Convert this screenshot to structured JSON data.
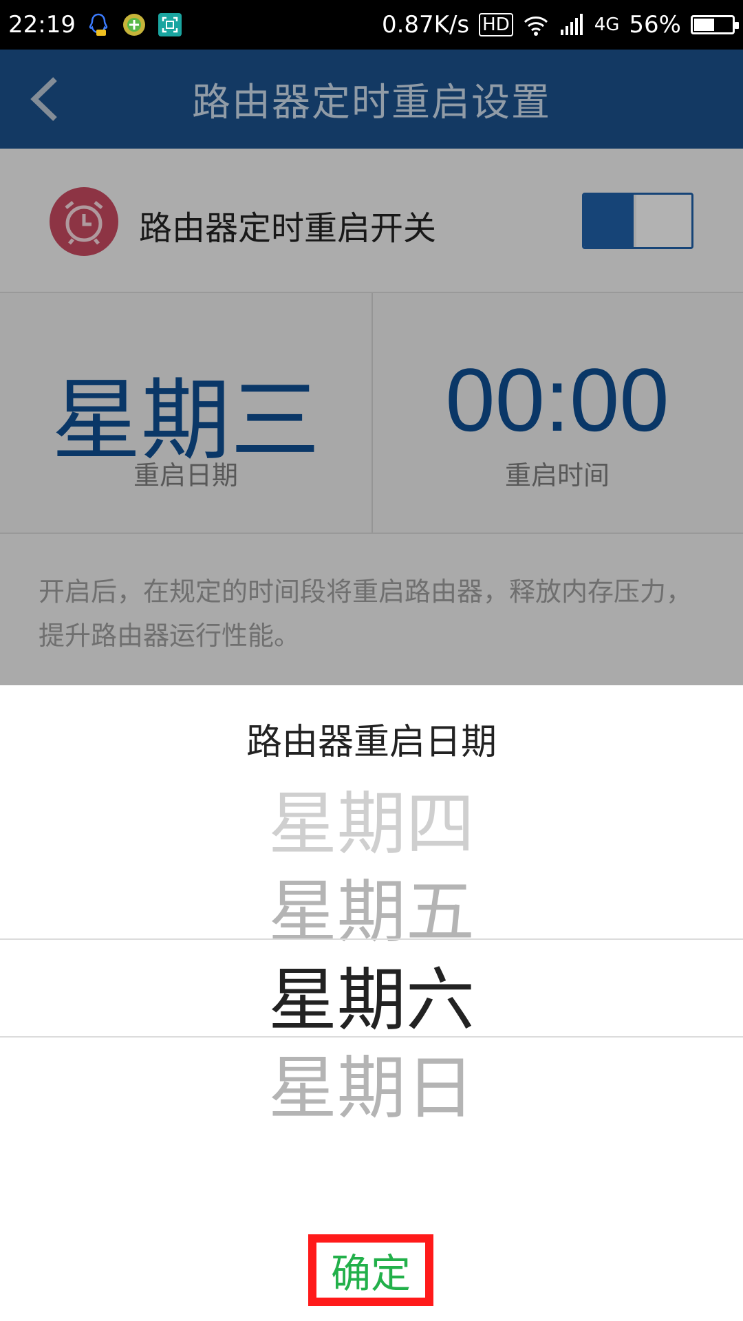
{
  "status_bar": {
    "time": "22:19",
    "speed": "0.87K/s",
    "hd": "HD",
    "network": "4G",
    "battery": "56%",
    "battery_level_percent": 56,
    "icons": [
      "qq-icon",
      "plus-badge-icon",
      "scan-icon",
      "wifi-icon",
      "signal-icon",
      "battery-icon"
    ]
  },
  "app_bar": {
    "title": "路由器定时重启设置"
  },
  "switch_row": {
    "label": "路由器定时重启开关",
    "enabled": true
  },
  "info": {
    "day_value": "星期三",
    "day_label": "重启日期",
    "time_value": "00:00",
    "time_label": "重启时间"
  },
  "description": "开启后，在规定的时间段将重启路由器，释放内存压力，提升路由器运行性能。",
  "sheet": {
    "title": "路由器重启日期",
    "items": [
      "星期四",
      "星期五",
      "星期六",
      "星期日"
    ],
    "selected": "星期六",
    "confirm_label": "确定"
  },
  "colors": {
    "app_bar": "#1b4f8a",
    "accent": "#0e4d8f",
    "confirm_text": "#22b04a",
    "highlight_border": "#ff1a1a",
    "alarm_icon": "#c4495f"
  }
}
